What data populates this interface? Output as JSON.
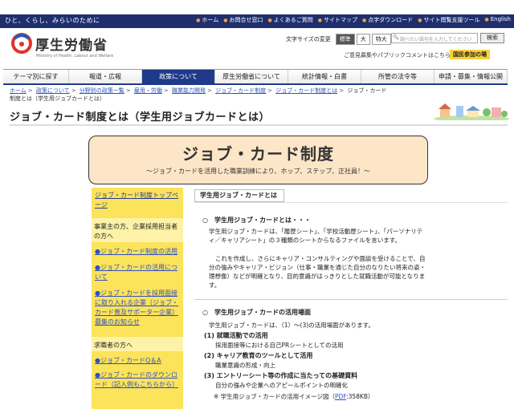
{
  "topbar": {
    "tagline": "ひと、くらし、みらいのために",
    "links": [
      "ホーム",
      "お問合せ窓口",
      "よくあるご質問",
      "サイトマップ",
      "点字ダウンロード",
      "サイト閲覧支援ツール",
      "English"
    ]
  },
  "header": {
    "site_title": "厚生労働省",
    "site_subtitle": "Ministry of Health, Labour and Welfare",
    "font_size_label": "文字サイズの変更",
    "font_sizes": [
      "標準",
      "大",
      "特大"
    ],
    "search_placeholder": "調べたい語句を入力してください",
    "search_button": "検索",
    "opinion_link": "ご意見募集やパブリックコメントはこちら",
    "participate_button": "国民参加の場"
  },
  "nav": {
    "items": [
      "テーマ別に探す",
      "報道・広報",
      "政策について",
      "厚生労働省について",
      "統計情報・白書",
      "所管の法令等",
      "申請・募集・情報公開"
    ],
    "active_index": 2
  },
  "breadcrumb": {
    "links": [
      "ホーム",
      "政策について",
      "分野別の政策一覧",
      "雇用・労働",
      "職業能力開発",
      "ジョブ・カード制度",
      "ジョブ・カード制度とは"
    ],
    "current": "ジョブ・カード制度とは（学生用ジョブカードとは）"
  },
  "page": {
    "title": "ジョブ・カード制度とは（学生用ジョブカードとは）"
  },
  "banner": {
    "title": "ジョブ・カード制度",
    "subtitle": "～ジョブ・カードを活用した職業訓練により、ホップ、ステップ、正社員！～"
  },
  "sidebar": {
    "top_link": "ジョブ・カード制度トップページ",
    "sections": [
      {
        "title": "事業主の方、企業採用担当者の方へ",
        "links": [
          "●ジョブ・カード制度の活用",
          "●ジョブ・カードの活用について",
          "●ジョブ・カードを採用面接に取り入れる企業（ジョブ・カード普及サポーター企業）募集のお知らせ"
        ]
      },
      {
        "title": "求職者の方へ",
        "links": [
          "●ジョブ・カードQ＆A",
          "●ジョブ・カードのダウンロード（記入例もこちらから）"
        ]
      }
    ]
  },
  "main": {
    "tab_label": "学生用ジョブ・カードとは",
    "section1": {
      "heading": "学生用ジョブ・カードとは・・・",
      "para1": "学生用ジョブ・カードは、「履歴シート」、「学校活動歴シート」、「パーソナリティ／キャリアシート」の３種類のシートからなるファイルを言います。",
      "para2": "これを作成し、さらにキャリア・コンサルティングや面談を受けることで、自分の強みやキャリア・ビジョン（仕事・職業を通じた自分のなりたい将来の姿・理想像）などが明確となり、目的意識がはっきりとした就職活動が可能となります。"
    },
    "section2": {
      "heading": "学生用ジョブ・カードの活用場面",
      "intro": "学生用ジョブ・カードは、（1）～(3)の活用場面があります。",
      "uses": [
        {
          "title": "(1) 就職活動での活用",
          "detail": "採用面接等における自己PRシートとしての活用"
        },
        {
          "title": "(2) キャリア教育のツールとして活用",
          "detail": "職業意識の形成・向上"
        },
        {
          "title": "(3) エントリーシート等の作成に当たっての基礎資料",
          "detail": "自分の強みや企業へのアピールポイントの明確化"
        }
      ],
      "note_prefix": "※ 学生用ジョブ・カードの活用イメージ図（",
      "note_pdf": "PDF",
      "note_suffix": ":358KB）"
    }
  },
  "colors": {
    "topbar": "#1f2f6e",
    "nav_active": "#1f3a8a",
    "sidebar": "#fbe35a",
    "banner": "#fde5c8",
    "link": "#2b56b6"
  }
}
